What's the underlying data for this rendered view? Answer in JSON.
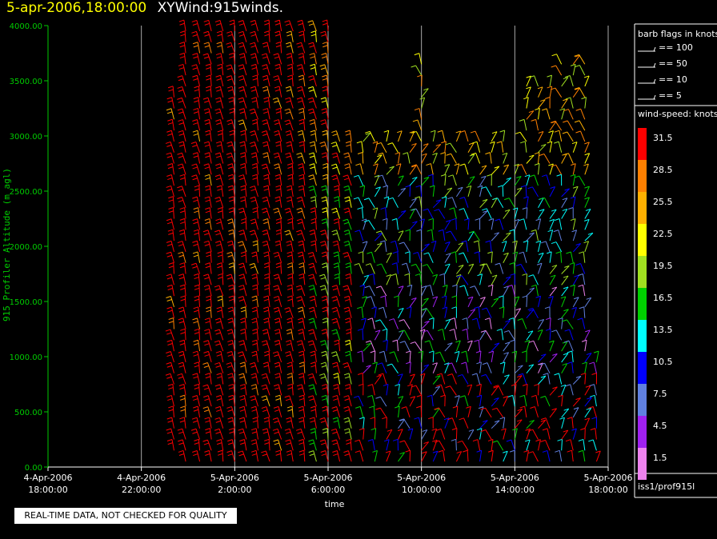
{
  "header": {
    "time": "5-apr-2006,18:00:00",
    "title": "XYWind:915winds."
  },
  "chart_data": {
    "type": "scatter",
    "ylabel": "915 Profiler Altitude (m agl)",
    "xlabel": "time",
    "ylim": [
      0,
      4000
    ],
    "yticks": [
      "4000.00",
      "3500.00",
      "3000.00",
      "2500.00",
      "2000.00",
      "1500.00",
      "1000.00",
      "500.00",
      "0.00"
    ],
    "xticks": [
      {
        "l1": "4-Apr-2006",
        "l2": "18:00:00"
      },
      {
        "l1": "4-Apr-2006",
        "l2": "22:00:00"
      },
      {
        "l1": "5-Apr-2006",
        "l2": "2:00:00"
      },
      {
        "l1": "5-Apr-2006",
        "l2": "6:00:00"
      },
      {
        "l1": "5-Apr-2006",
        "l2": "10:00:00"
      },
      {
        "l1": "5-Apr-2006",
        "l2": "14:00:00"
      },
      {
        "l1": "5-Apr-2006",
        "l2": "18:00:00"
      }
    ],
    "grid": true,
    "series_note": "wind barbs at each profile time, colored by wind speed",
    "profiles": [
      {
        "t": 5.4,
        "bottom": 150,
        "top": 3400,
        "speed": "high"
      },
      {
        "t": 5.9,
        "bottom": 50,
        "top": 4000,
        "speed": "high"
      },
      {
        "t": 6.5,
        "bottom": 50,
        "top": 4000,
        "speed": "high"
      },
      {
        "t": 7.0,
        "bottom": 50,
        "top": 4000,
        "speed": "high"
      },
      {
        "t": 7.5,
        "bottom": 50,
        "top": 4000,
        "speed": "high"
      },
      {
        "t": 8.0,
        "bottom": 50,
        "top": 4000,
        "speed": "high"
      },
      {
        "t": 8.5,
        "bottom": 50,
        "top": 4000,
        "speed": "high"
      },
      {
        "t": 9.0,
        "bottom": 50,
        "top": 4000,
        "speed": "high"
      },
      {
        "t": 9.5,
        "bottom": 50,
        "top": 4000,
        "speed": "high"
      },
      {
        "t": 10.0,
        "bottom": 50,
        "top": 4000,
        "speed": "high"
      },
      {
        "t": 10.5,
        "bottom": 50,
        "top": 4000,
        "speed": "high"
      },
      {
        "t": 11.0,
        "bottom": 50,
        "top": 4000,
        "speed": "high"
      },
      {
        "t": 11.5,
        "bottom": 50,
        "top": 4000,
        "speed": "mixed"
      },
      {
        "t": 12.0,
        "bottom": 50,
        "top": 4000,
        "speed": "mixed"
      },
      {
        "t": 12.5,
        "bottom": 50,
        "top": 3000,
        "speed": "mixed"
      },
      {
        "t": 13.0,
        "bottom": 50,
        "top": 3000,
        "speed": "mixed"
      },
      {
        "t": 13.5,
        "bottom": 50,
        "top": 3000,
        "speed": "low"
      },
      {
        "t": 14.0,
        "bottom": 50,
        "top": 3000,
        "speed": "low"
      },
      {
        "t": 14.5,
        "bottom": 50,
        "top": 3000,
        "speed": "low"
      },
      {
        "t": 15.0,
        "bottom": 50,
        "top": 3000,
        "speed": "low"
      },
      {
        "t": 15.5,
        "bottom": 50,
        "top": 3000,
        "speed": "low"
      },
      {
        "t": 16.0,
        "bottom": 50,
        "top": 3700,
        "speed": "low"
      },
      {
        "t": 16.5,
        "bottom": 50,
        "top": 3000,
        "speed": "low"
      },
      {
        "t": 17.0,
        "bottom": 50,
        "top": 3000,
        "speed": "low"
      },
      {
        "t": 17.5,
        "bottom": 50,
        "top": 3000,
        "speed": "low"
      },
      {
        "t": 18.0,
        "bottom": 50,
        "top": 3000,
        "speed": "low"
      },
      {
        "t": 18.5,
        "bottom": 50,
        "top": 3000,
        "speed": "low"
      },
      {
        "t": 19.0,
        "bottom": 50,
        "top": 3000,
        "speed": "low"
      },
      {
        "t": 19.5,
        "bottom": 50,
        "top": 3000,
        "speed": "low"
      },
      {
        "t": 20.0,
        "bottom": 50,
        "top": 2700,
        "speed": "low"
      },
      {
        "t": 20.5,
        "bottom": 50,
        "top": 3500,
        "speed": "low"
      },
      {
        "t": 21.0,
        "bottom": 50,
        "top": 3500,
        "speed": "low"
      },
      {
        "t": 21.5,
        "bottom": 50,
        "top": 3500,
        "speed": "low"
      },
      {
        "t": 22.0,
        "bottom": 50,
        "top": 3650,
        "speed": "low"
      },
      {
        "t": 22.5,
        "bottom": 50,
        "top": 3700,
        "speed": "low"
      },
      {
        "t": 23.0,
        "bottom": 50,
        "top": 3700,
        "speed": "low"
      },
      {
        "t": 23.5,
        "bottom": 50,
        "top": 1000,
        "speed": "low"
      }
    ]
  },
  "legend": {
    "barb_title": "barb flags in knots",
    "barbs": [
      {
        "label": "== 100"
      },
      {
        "label": "== 50"
      },
      {
        "label": "== 10"
      },
      {
        "label": "== 5"
      }
    ],
    "speed_title": "wind-speed: knots",
    "speeds": [
      {
        "label": "31.5",
        "color": "#ff0000"
      },
      {
        "label": "28.5",
        "color": "#ff8000"
      },
      {
        "label": "25.5",
        "color": "#ffb000"
      },
      {
        "label": "22.5",
        "color": "#ffff00"
      },
      {
        "label": "19.5",
        "color": "#a0e020"
      },
      {
        "label": "16.5",
        "color": "#00d000"
      },
      {
        "label": "13.5",
        "color": "#00ffff"
      },
      {
        "label": "10.5",
        "color": "#0000ff"
      },
      {
        "label": "7.5",
        "color": "#6080e0"
      },
      {
        "label": "4.5",
        "color": "#a020f0"
      },
      {
        "label": "1.5",
        "color": "#ee82ee"
      }
    ],
    "source": "iss1/prof915l"
  },
  "footer": {
    "notice": "REAL-TIME DATA, NOT CHECKED FOR QUALITY"
  },
  "colors": {
    "axis": "#00cc00",
    "grid": "#aaaaaa",
    "background": "#000000"
  }
}
